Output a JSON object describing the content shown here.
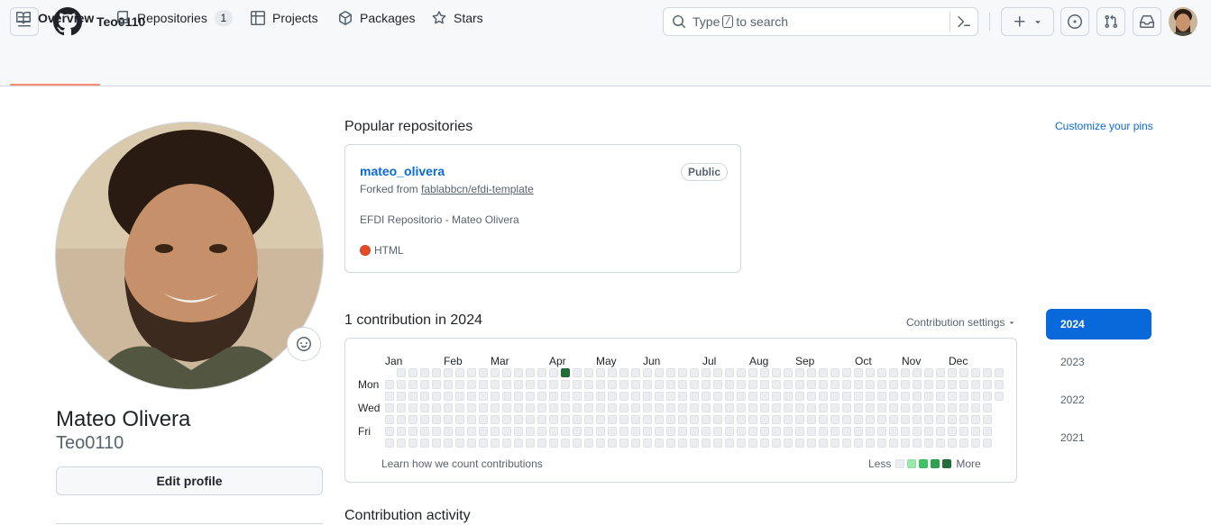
{
  "header": {
    "username": "Teo0110",
    "search_prefix": "Type",
    "search_key": "/",
    "search_suffix": "to search",
    "icons": [
      "hamburger-icon",
      "github-logo",
      "search-icon",
      "command-palette-icon",
      "plus-icon",
      "triangle-down-icon",
      "issues-icon",
      "pull-requests-icon",
      "inbox-icon",
      "avatar"
    ]
  },
  "tabs": [
    {
      "label": "Overview",
      "icon": "book-icon",
      "selected": true
    },
    {
      "label": "Repositories",
      "icon": "repo-icon",
      "count": "1"
    },
    {
      "label": "Projects",
      "icon": "table-icon"
    },
    {
      "label": "Packages",
      "icon": "package-icon"
    },
    {
      "label": "Stars",
      "icon": "star-icon"
    }
  ],
  "profile": {
    "full_name": "Mateo Olivera",
    "login": "Teo0110",
    "edit_label": "Edit profile",
    "status_icon": "smiley-icon"
  },
  "pinned": {
    "title": "Popular repositories",
    "customize": "Customize your pins",
    "repo": {
      "name": "mateo_olivera",
      "visibility": "Public",
      "forked_prefix": "Forked from",
      "forked_source": "fablabbcn/efdi-template",
      "description": "EFDI Repositorio - Mateo Olivera",
      "language": "HTML",
      "language_color": "#e34c26"
    }
  },
  "contributions": {
    "title": "1 contribution in 2024",
    "settings": "Contribution settings",
    "months": [
      "Jan",
      "Feb",
      "Mar",
      "Apr",
      "May",
      "Jun",
      "Jul",
      "Aug",
      "Sep",
      "Oct",
      "Nov",
      "Dec"
    ],
    "days": [
      "Mon",
      "Wed",
      "Fri"
    ],
    "learn": "Learn how we count contributions",
    "less": "Less",
    "more": "More",
    "active_cell": {
      "week": 15,
      "day": 0,
      "level": 4
    },
    "colors": [
      "#ebedf0",
      "#9be9a8",
      "#40c463",
      "#30a14e",
      "#216e39"
    ]
  },
  "years": [
    "2024",
    "2023",
    "2022",
    "2021"
  ],
  "active_year": "2024",
  "activity": {
    "title": "Contribution activity"
  }
}
